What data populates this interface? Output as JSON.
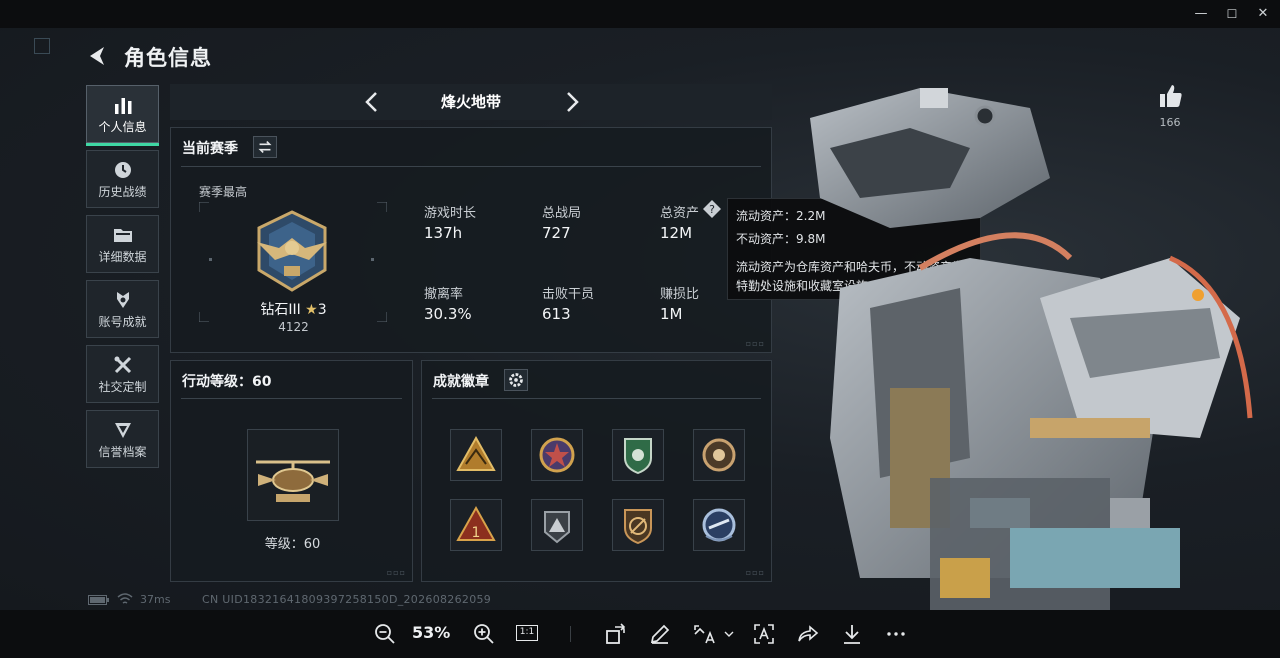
{
  "window": {
    "min_glyph": "—",
    "max_glyph": "☐",
    "close_glyph": "✕"
  },
  "header": {
    "title": "角色信息"
  },
  "sidebar": {
    "items": [
      {
        "label": "个人信息",
        "icon": "bar-chart-icon",
        "active": true
      },
      {
        "label": "历史战绩",
        "icon": "clock-icon"
      },
      {
        "label": "详细数据",
        "icon": "folder-icon"
      },
      {
        "label": "账号成就",
        "icon": "achievement-icon"
      },
      {
        "label": "社交定制",
        "icon": "tools-icon"
      },
      {
        "label": "信誉档案",
        "icon": "shield-icon"
      }
    ]
  },
  "mode": {
    "name": "烽火地带"
  },
  "season": {
    "heading": "当前赛季",
    "best_label": "赛季最高",
    "rank_name": "钻石III",
    "rank_stars": "3",
    "rank_points": "4122",
    "stats": [
      {
        "label": "游戏时长",
        "value": "137h"
      },
      {
        "label": "总战局",
        "value": "727"
      },
      {
        "label": "总资产",
        "value": "12M"
      },
      {
        "label": "撤离率",
        "value": "30.3%"
      },
      {
        "label": "击败干员",
        "value": "613"
      },
      {
        "label": "赚损比",
        "value": "1M"
      }
    ]
  },
  "tooltip": {
    "line1": "流动资产：2.2M",
    "line2": "不动资产：9.8M",
    "line3": "流动资产为仓库资产和哈夫币，不动资产为",
    "line4": "特勤处设施和收藏室设施"
  },
  "action_level": {
    "heading": "行动等级：60",
    "caption": "等级：60"
  },
  "achievements": {
    "heading": "成就徽章",
    "badges": [
      {
        "icon": "triangle-badge-icon",
        "color": "#d2a64a"
      },
      {
        "icon": "star-medal-icon",
        "color": "#c0504a"
      },
      {
        "icon": "green-shield-icon",
        "color": "#3f8f5a"
      },
      {
        "icon": "round-emblem-icon",
        "color": "#b9905a"
      },
      {
        "icon": "number-one-badge-icon",
        "color": "#c74b2d"
      },
      {
        "icon": "mountain-badge-icon",
        "color": "#8a8f94"
      },
      {
        "icon": "slash-shield-icon",
        "color": "#b37a3a"
      },
      {
        "icon": "blue-crest-icon",
        "color": "#5a7fb0"
      }
    ]
  },
  "likes": {
    "count": "166"
  },
  "status": {
    "ping": "37ms",
    "uid": "CN UID18321641809397258150D_202608262059"
  },
  "viewer": {
    "zoom": "53%",
    "actual_size": "1:1"
  }
}
